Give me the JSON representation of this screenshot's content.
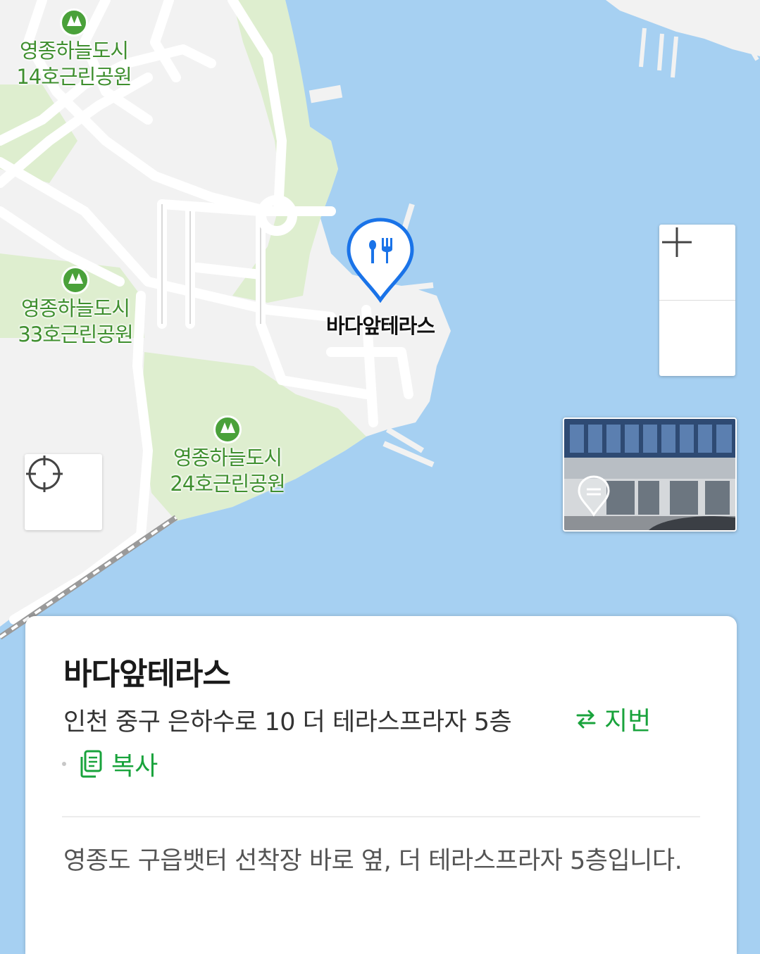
{
  "map": {
    "parks": [
      {
        "line1": "영종하늘도시",
        "line2": "14호근린공원"
      },
      {
        "line1": "영종하늘도시",
        "line2": "33호근린공원"
      },
      {
        "line1": "영종하늘도시",
        "line2": "24호근린공원"
      }
    ],
    "pin": {
      "label": "바다앞테라스",
      "icon": "restaurant-icon",
      "color": "#1a73e8"
    },
    "zoom_in_icon": "plus-icon",
    "zoom_out_icon": "minus-icon",
    "locate_icon": "crosshair-icon",
    "street_view_icon": "street-view-pin-icon"
  },
  "place": {
    "name": "바다앞테라스",
    "address": "인천 중구 은하수로 10 더 테라스프라자 5층",
    "jibun_label": "지번",
    "copy_label": "복사",
    "description": "영종도 구읍뱃터 선착장 바로 옆, 더 테라스프라자 5층입니다."
  },
  "colors": {
    "water": "#a6d0f2",
    "land": "#f2f2f2",
    "park": "#deeecf",
    "accent_green": "#19a33c",
    "pin_blue": "#1a73e8"
  }
}
